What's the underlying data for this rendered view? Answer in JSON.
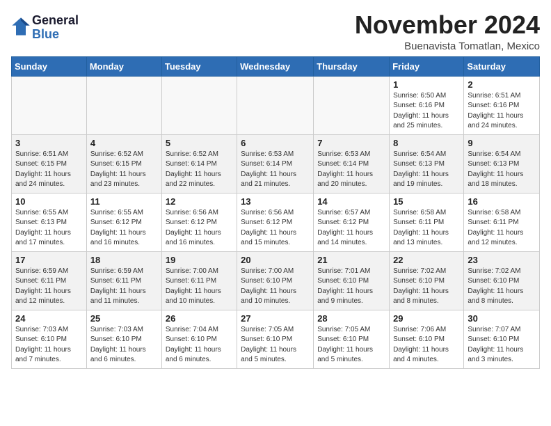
{
  "logo": {
    "line1": "General",
    "line2": "Blue"
  },
  "title": "November 2024",
  "subtitle": "Buenavista Tomatlan, Mexico",
  "days_of_week": [
    "Sunday",
    "Monday",
    "Tuesday",
    "Wednesday",
    "Thursday",
    "Friday",
    "Saturday"
  ],
  "weeks": [
    [
      {
        "day": "",
        "info": ""
      },
      {
        "day": "",
        "info": ""
      },
      {
        "day": "",
        "info": ""
      },
      {
        "day": "",
        "info": ""
      },
      {
        "day": "",
        "info": ""
      },
      {
        "day": "1",
        "info": "Sunrise: 6:50 AM\nSunset: 6:16 PM\nDaylight: 11 hours\nand 25 minutes."
      },
      {
        "day": "2",
        "info": "Sunrise: 6:51 AM\nSunset: 6:16 PM\nDaylight: 11 hours\nand 24 minutes."
      }
    ],
    [
      {
        "day": "3",
        "info": "Sunrise: 6:51 AM\nSunset: 6:15 PM\nDaylight: 11 hours\nand 24 minutes."
      },
      {
        "day": "4",
        "info": "Sunrise: 6:52 AM\nSunset: 6:15 PM\nDaylight: 11 hours\nand 23 minutes."
      },
      {
        "day": "5",
        "info": "Sunrise: 6:52 AM\nSunset: 6:14 PM\nDaylight: 11 hours\nand 22 minutes."
      },
      {
        "day": "6",
        "info": "Sunrise: 6:53 AM\nSunset: 6:14 PM\nDaylight: 11 hours\nand 21 minutes."
      },
      {
        "day": "7",
        "info": "Sunrise: 6:53 AM\nSunset: 6:14 PM\nDaylight: 11 hours\nand 20 minutes."
      },
      {
        "day": "8",
        "info": "Sunrise: 6:54 AM\nSunset: 6:13 PM\nDaylight: 11 hours\nand 19 minutes."
      },
      {
        "day": "9",
        "info": "Sunrise: 6:54 AM\nSunset: 6:13 PM\nDaylight: 11 hours\nand 18 minutes."
      }
    ],
    [
      {
        "day": "10",
        "info": "Sunrise: 6:55 AM\nSunset: 6:13 PM\nDaylight: 11 hours\nand 17 minutes."
      },
      {
        "day": "11",
        "info": "Sunrise: 6:55 AM\nSunset: 6:12 PM\nDaylight: 11 hours\nand 16 minutes."
      },
      {
        "day": "12",
        "info": "Sunrise: 6:56 AM\nSunset: 6:12 PM\nDaylight: 11 hours\nand 16 minutes."
      },
      {
        "day": "13",
        "info": "Sunrise: 6:56 AM\nSunset: 6:12 PM\nDaylight: 11 hours\nand 15 minutes."
      },
      {
        "day": "14",
        "info": "Sunrise: 6:57 AM\nSunset: 6:12 PM\nDaylight: 11 hours\nand 14 minutes."
      },
      {
        "day": "15",
        "info": "Sunrise: 6:58 AM\nSunset: 6:11 PM\nDaylight: 11 hours\nand 13 minutes."
      },
      {
        "day": "16",
        "info": "Sunrise: 6:58 AM\nSunset: 6:11 PM\nDaylight: 11 hours\nand 12 minutes."
      }
    ],
    [
      {
        "day": "17",
        "info": "Sunrise: 6:59 AM\nSunset: 6:11 PM\nDaylight: 11 hours\nand 12 minutes."
      },
      {
        "day": "18",
        "info": "Sunrise: 6:59 AM\nSunset: 6:11 PM\nDaylight: 11 hours\nand 11 minutes."
      },
      {
        "day": "19",
        "info": "Sunrise: 7:00 AM\nSunset: 6:11 PM\nDaylight: 11 hours\nand 10 minutes."
      },
      {
        "day": "20",
        "info": "Sunrise: 7:00 AM\nSunset: 6:10 PM\nDaylight: 11 hours\nand 10 minutes."
      },
      {
        "day": "21",
        "info": "Sunrise: 7:01 AM\nSunset: 6:10 PM\nDaylight: 11 hours\nand 9 minutes."
      },
      {
        "day": "22",
        "info": "Sunrise: 7:02 AM\nSunset: 6:10 PM\nDaylight: 11 hours\nand 8 minutes."
      },
      {
        "day": "23",
        "info": "Sunrise: 7:02 AM\nSunset: 6:10 PM\nDaylight: 11 hours\nand 8 minutes."
      }
    ],
    [
      {
        "day": "24",
        "info": "Sunrise: 7:03 AM\nSunset: 6:10 PM\nDaylight: 11 hours\nand 7 minutes."
      },
      {
        "day": "25",
        "info": "Sunrise: 7:03 AM\nSunset: 6:10 PM\nDaylight: 11 hours\nand 6 minutes."
      },
      {
        "day": "26",
        "info": "Sunrise: 7:04 AM\nSunset: 6:10 PM\nDaylight: 11 hours\nand 6 minutes."
      },
      {
        "day": "27",
        "info": "Sunrise: 7:05 AM\nSunset: 6:10 PM\nDaylight: 11 hours\nand 5 minutes."
      },
      {
        "day": "28",
        "info": "Sunrise: 7:05 AM\nSunset: 6:10 PM\nDaylight: 11 hours\nand 5 minutes."
      },
      {
        "day": "29",
        "info": "Sunrise: 7:06 AM\nSunset: 6:10 PM\nDaylight: 11 hours\nand 4 minutes."
      },
      {
        "day": "30",
        "info": "Sunrise: 7:07 AM\nSunset: 6:10 PM\nDaylight: 11 hours\nand 3 minutes."
      }
    ]
  ]
}
